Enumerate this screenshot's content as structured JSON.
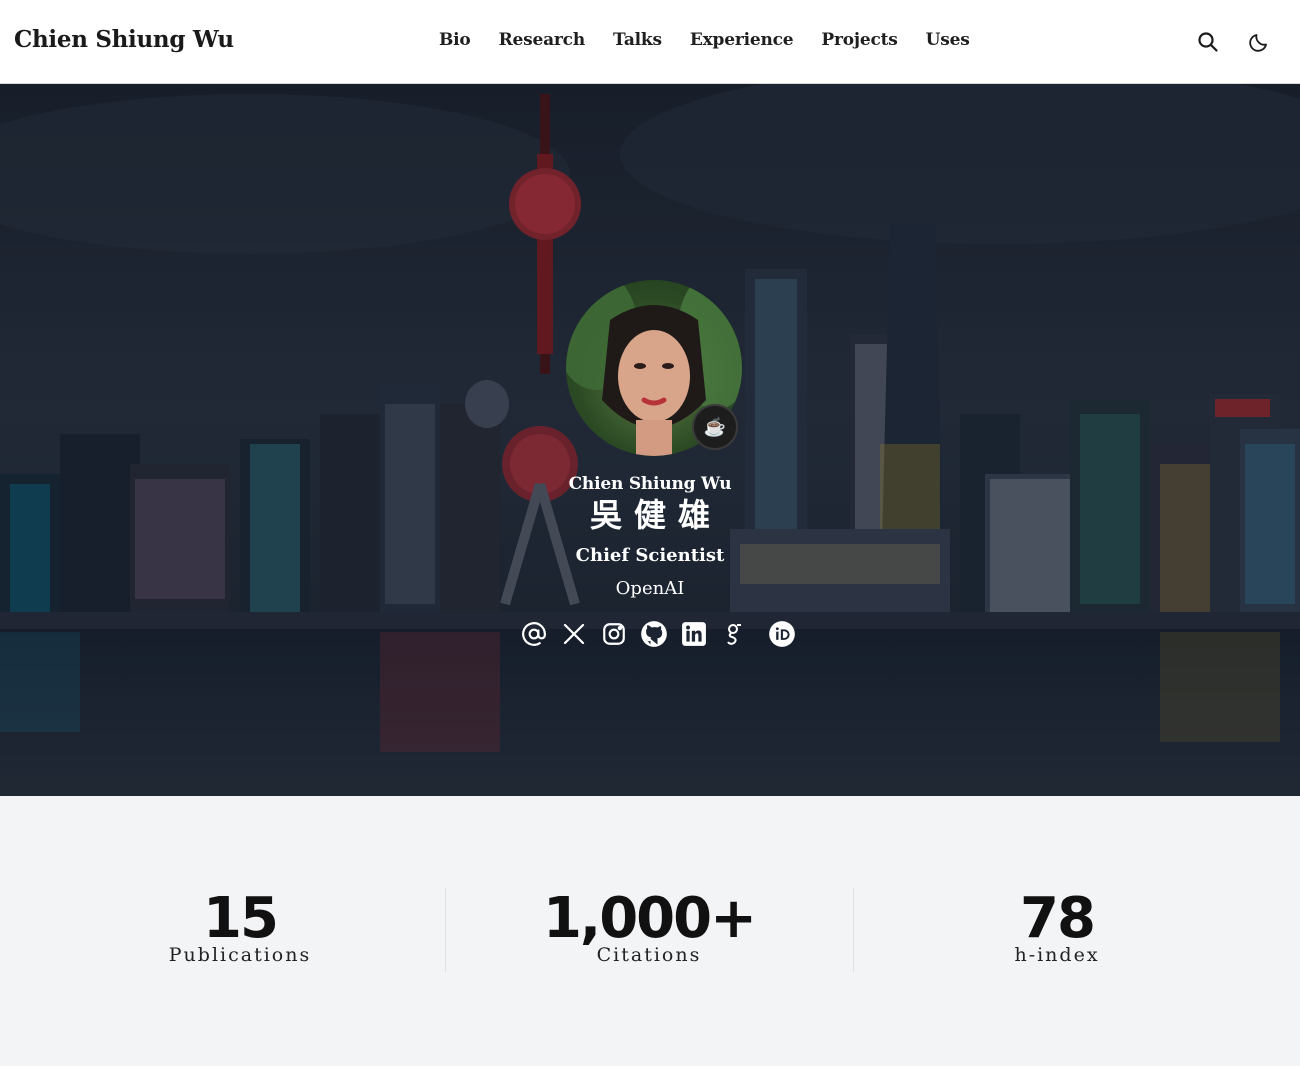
{
  "header": {
    "brand": "Chien Shiung Wu",
    "nav": [
      {
        "label": "Bio"
      },
      {
        "label": "Research"
      },
      {
        "label": "Talks"
      },
      {
        "label": "Experience"
      },
      {
        "label": "Projects"
      },
      {
        "label": "Uses"
      }
    ],
    "icons": [
      "search-icon",
      "moon-icon"
    ]
  },
  "hero": {
    "name": "Chien Shiung Wu",
    "name_cn": "吳健雄",
    "role": "Chief Scientist",
    "organization": "OpenAI",
    "status_emoji": "☕",
    "socials": [
      "at-icon",
      "x-icon",
      "instagram-icon",
      "github-icon",
      "linkedin-icon",
      "google-scholar-icon",
      "orcid-icon"
    ]
  },
  "stats": [
    {
      "value": "15",
      "label": "Publications"
    },
    {
      "value": "1,000+",
      "label": "Citations"
    },
    {
      "value": "78",
      "label": "h-index"
    }
  ]
}
